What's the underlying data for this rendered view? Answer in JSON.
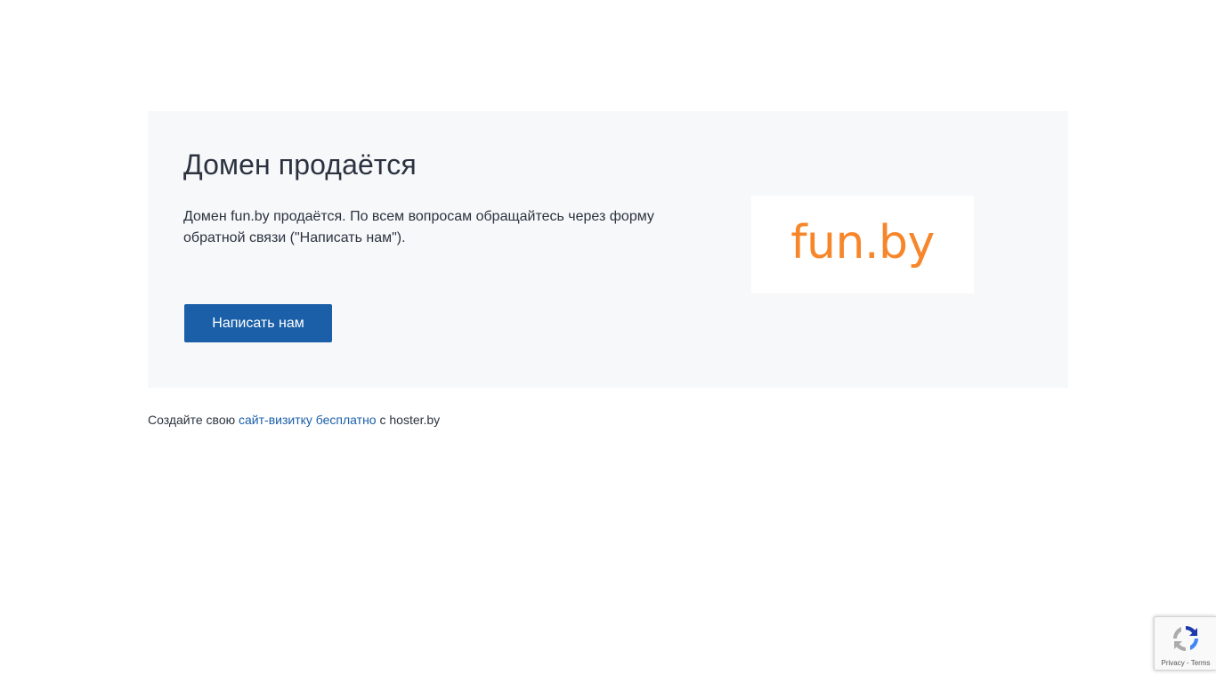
{
  "sale": {
    "title": "Домен продаётся",
    "description": "Домен fun.by продаётся. По всем вопросам обращайтесь через форму обратной связи (\"Написать нам\").",
    "button_label": "Написать нам",
    "logo_text": "fun.by"
  },
  "footer": {
    "prefix": "Создайте свою ",
    "link_label": "сайт-визитку бесплатно",
    "suffix": " с hoster.by"
  },
  "recaptcha": {
    "privacy_label": "Privacy",
    "separator": " - ",
    "terms_label": "Terms"
  },
  "colors": {
    "accent": "#1a5fa8",
    "logo": "#f7862a",
    "card_background": "#f7f8fa",
    "text": "#2b3340"
  }
}
